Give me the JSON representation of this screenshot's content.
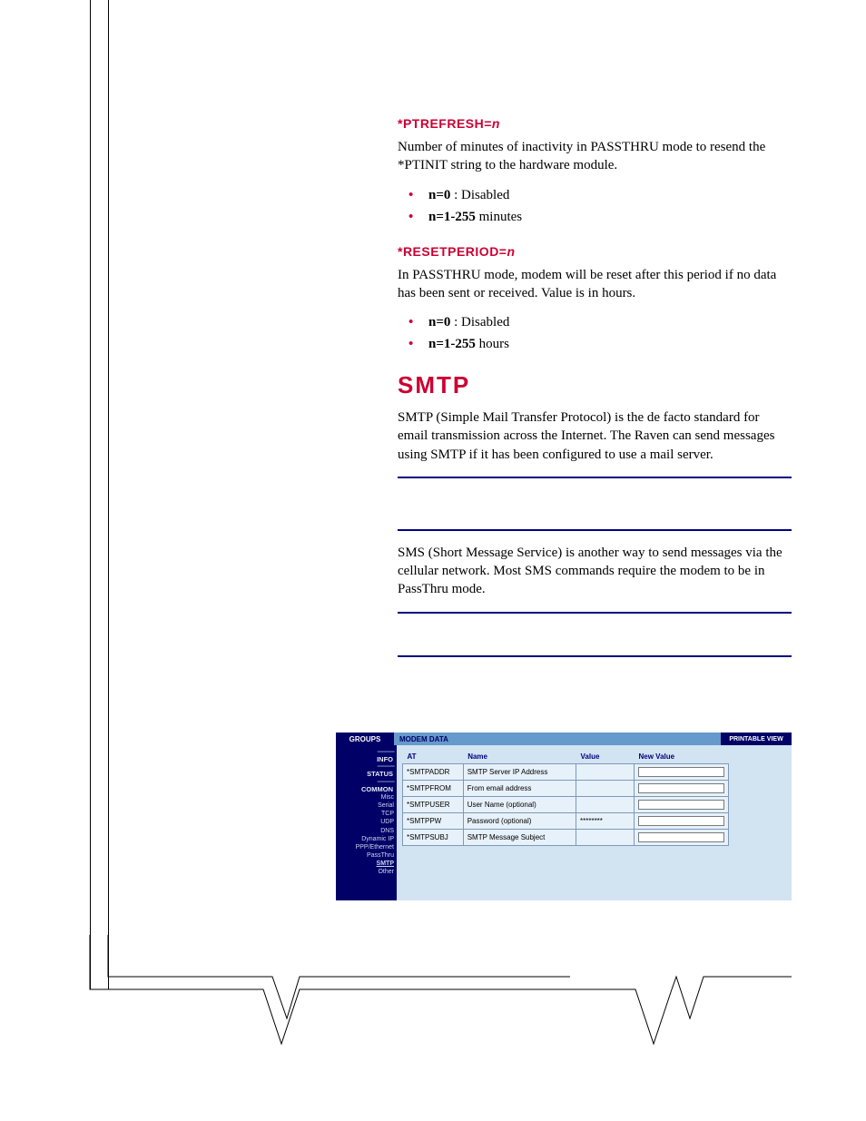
{
  "commands": {
    "ptrefresh": {
      "heading": "*PTREFRESH=",
      "param": "n",
      "desc": "Number of minutes of inactivity in PASSTHRU mode to resend the *PTINIT string to the hardware module.",
      "opts": [
        {
          "bold": "n=0",
          "rest": " : Disabled"
        },
        {
          "bold": "n=1-255",
          "rest": " minutes"
        }
      ]
    },
    "resetperiod": {
      "heading": "*RESETPERIOD=",
      "param": "n",
      "desc": "In PASSTHRU mode, modem will be reset after this period if no data has been sent or received. Value is in hours.",
      "opts": [
        {
          "bold": "n=0",
          "rest": " : Disabled"
        },
        {
          "bold": "n=1-255",
          "rest": " hours"
        }
      ]
    }
  },
  "section": {
    "title": "SMTP",
    "para1": "SMTP (Simple Mail Transfer Protocol) is the de facto standard for email transmission across the Internet. The Raven can send messages using SMTP if it has been configured to use a mail server.",
    "para2": "SMS (Short Message Service) is another way to send messages via the cellular network. Most SMS commands require the modem to be in PassThru mode."
  },
  "admin": {
    "tabs": {
      "groups": "GROUPS",
      "modem": "MODEM DATA",
      "printable": "PRINTABLE VIEW"
    },
    "sidebar": {
      "dash": "--------------",
      "info": "INFO",
      "status": "STATUS",
      "common": "COMMON",
      "subs": [
        "Misc",
        "Serial",
        "TCP",
        "UDP",
        "DNS",
        "Dynamic IP",
        "PPP/Ethernet",
        "PassThru",
        "SMTP",
        "Other"
      ],
      "active_sub": "SMTP"
    },
    "chart_data": {
      "type": "table",
      "columns": [
        "AT",
        "Name",
        "Value",
        "New Value"
      ],
      "rows": [
        {
          "at": "*SMTPADDR",
          "name": "SMTP Server IP Address",
          "value": "",
          "new_value": ""
        },
        {
          "at": "*SMTPFROM",
          "name": "From email address",
          "value": "",
          "new_value": ""
        },
        {
          "at": "*SMTPUSER",
          "name": "User Name (optional)",
          "value": "",
          "new_value": ""
        },
        {
          "at": "*SMTPPW",
          "name": "Password (optional)",
          "value": "********",
          "new_value": ""
        },
        {
          "at": "*SMTPSUBJ",
          "name": "SMTP Message Subject",
          "value": "",
          "new_value": ""
        }
      ]
    }
  }
}
